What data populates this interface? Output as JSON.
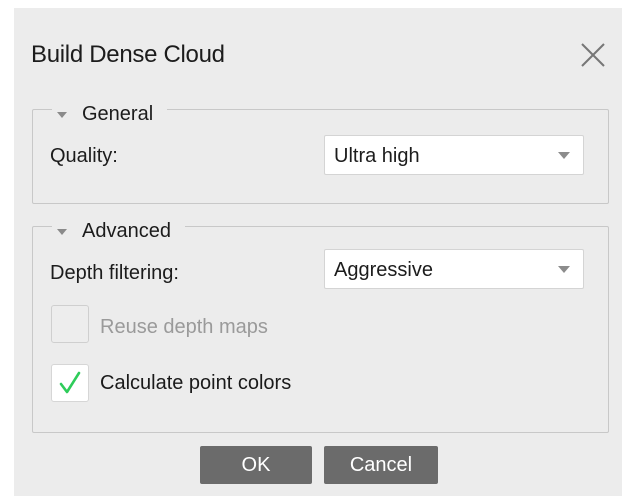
{
  "dialog": {
    "title": "Build Dense Cloud",
    "close_icon": "close-icon"
  },
  "general": {
    "header": "General",
    "quality_label": "Quality:",
    "quality_value": "Ultra high"
  },
  "advanced": {
    "header": "Advanced",
    "depth_filtering_label": "Depth filtering:",
    "depth_filtering_value": "Aggressive",
    "reuse_depth_maps_label": "Reuse depth maps",
    "reuse_depth_maps_checked": false,
    "reuse_depth_maps_enabled": false,
    "calculate_point_colors_label": "Calculate point colors",
    "calculate_point_colors_checked": true
  },
  "buttons": {
    "ok": "OK",
    "cancel": "Cancel"
  },
  "colors": {
    "dialog_bg": "#ececec",
    "button_bg": "#6b6b6b",
    "checkmark": "#2ecc5a"
  }
}
